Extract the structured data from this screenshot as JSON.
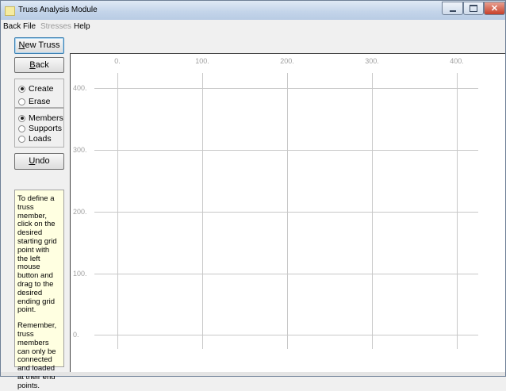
{
  "window": {
    "title": "Truss Analysis Module"
  },
  "menu": [
    {
      "label": "Back"
    },
    {
      "label": "File"
    },
    {
      "label": "Stresses"
    },
    {
      "label": "Help"
    }
  ],
  "buttons": {
    "new_truss": {
      "accel": "N",
      "rest": "ew Truss"
    },
    "back": {
      "accel": "B",
      "rest": "ack"
    },
    "undo": {
      "accel": "U",
      "rest": "ndo"
    }
  },
  "mode_group": {
    "options": [
      {
        "label": "Create",
        "selected": true
      },
      {
        "label": "Erase",
        "selected": false
      }
    ]
  },
  "element_group": {
    "options": [
      {
        "label": "Members",
        "selected": true
      },
      {
        "label": "Supports",
        "selected": false
      },
      {
        "label": "Loads",
        "selected": false
      }
    ]
  },
  "help_text": {
    "para1": "To define a truss member, click on the desired starting grid point with the left mouse button and drag to the desired ending grid point.",
    "para2": "Remember, truss members can only be connected and loaded at their end points."
  },
  "grid": {
    "x_labels": [
      "0.",
      "100.",
      "200.",
      "300.",
      "400."
    ],
    "y_labels": [
      "400.",
      "300.",
      "200.",
      "100.",
      "0."
    ]
  },
  "colors": {
    "help_background": "#ffffe1",
    "grid_line": "#c8c8c8",
    "axis_label": "#a0a0a0"
  }
}
